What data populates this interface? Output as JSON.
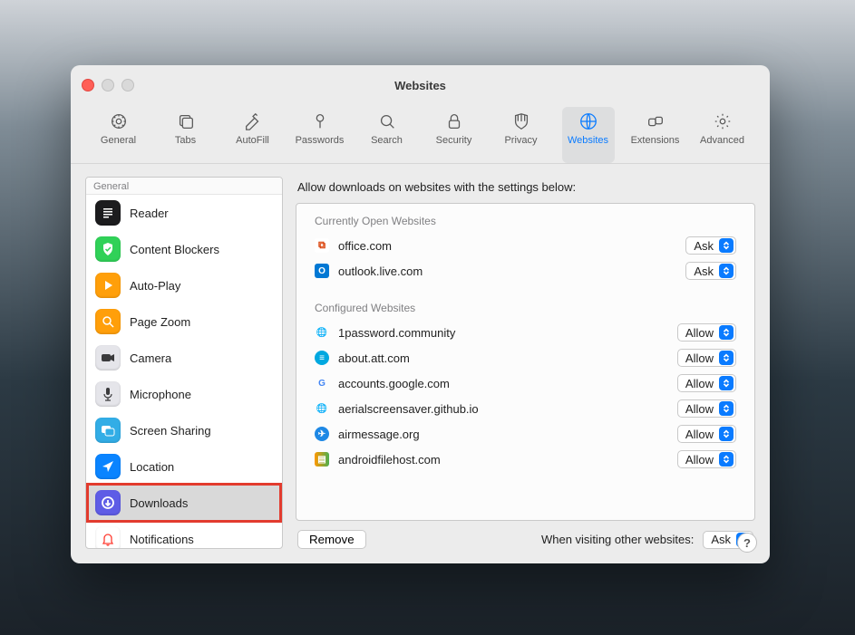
{
  "window": {
    "title": "Websites"
  },
  "toolbar": {
    "items": [
      {
        "label": "General"
      },
      {
        "label": "Tabs"
      },
      {
        "label": "AutoFill"
      },
      {
        "label": "Passwords"
      },
      {
        "label": "Search"
      },
      {
        "label": "Security"
      },
      {
        "label": "Privacy"
      },
      {
        "label": "Websites"
      },
      {
        "label": "Extensions"
      },
      {
        "label": "Advanced"
      }
    ],
    "selected_index": 7
  },
  "sidebar": {
    "header": "General",
    "items": [
      {
        "label": "Reader",
        "icon": "reader-icon",
        "bg": "#1c1c1e",
        "fg": "#ffffff"
      },
      {
        "label": "Content Blockers",
        "icon": "shield-icon",
        "bg": "#30d158",
        "fg": "#ffffff"
      },
      {
        "label": "Auto-Play",
        "icon": "play-icon",
        "bg": "#ff9f0a",
        "fg": "#ffffff"
      },
      {
        "label": "Page Zoom",
        "icon": "zoom-icon",
        "bg": "#ff9f0a",
        "fg": "#ffffff"
      },
      {
        "label": "Camera",
        "icon": "camera-icon",
        "bg": "#e5e5ea",
        "fg": "#3a3a3c"
      },
      {
        "label": "Microphone",
        "icon": "microphone-icon",
        "bg": "#e5e5ea",
        "fg": "#3a3a3c"
      },
      {
        "label": "Screen Sharing",
        "icon": "screens-icon",
        "bg": "#32ade6",
        "fg": "#ffffff"
      },
      {
        "label": "Location",
        "icon": "location-icon",
        "bg": "#0a84ff",
        "fg": "#ffffff"
      },
      {
        "label": "Downloads",
        "icon": "download-icon",
        "bg": "#5e5ce6",
        "fg": "#ffffff",
        "highlighted": true,
        "boxed": true
      },
      {
        "label": "Notifications",
        "icon": "bell-icon",
        "bg": "#ffffff",
        "fg": "#ff3b30"
      }
    ]
  },
  "main": {
    "instructions": "Allow downloads on websites with the settings below:",
    "open_header": "Currently Open Websites",
    "open_sites": [
      {
        "domain": "office.com",
        "setting": "Ask",
        "favicon": {
          "type": "office"
        }
      },
      {
        "domain": "outlook.live.com",
        "setting": "Ask",
        "favicon": {
          "type": "outlook"
        }
      }
    ],
    "configured_header": "Configured Websites",
    "configured_sites": [
      {
        "domain": "1password.community",
        "setting": "Allow",
        "favicon": {
          "type": "globe"
        }
      },
      {
        "domain": "about.att.com",
        "setting": "Allow",
        "favicon": {
          "type": "att"
        }
      },
      {
        "domain": "accounts.google.com",
        "setting": "Allow",
        "favicon": {
          "type": "google"
        }
      },
      {
        "domain": "aerialscreensaver.github.io",
        "setting": "Allow",
        "favicon": {
          "type": "globe"
        }
      },
      {
        "domain": "airmessage.org",
        "setting": "Allow",
        "favicon": {
          "type": "airmessage"
        }
      },
      {
        "domain": "androidfilehost.com",
        "setting": "Allow",
        "favicon": {
          "type": "afh"
        }
      }
    ],
    "remove_label": "Remove",
    "other_label": "When visiting other websites:",
    "other_setting": "Ask"
  },
  "help": "?"
}
